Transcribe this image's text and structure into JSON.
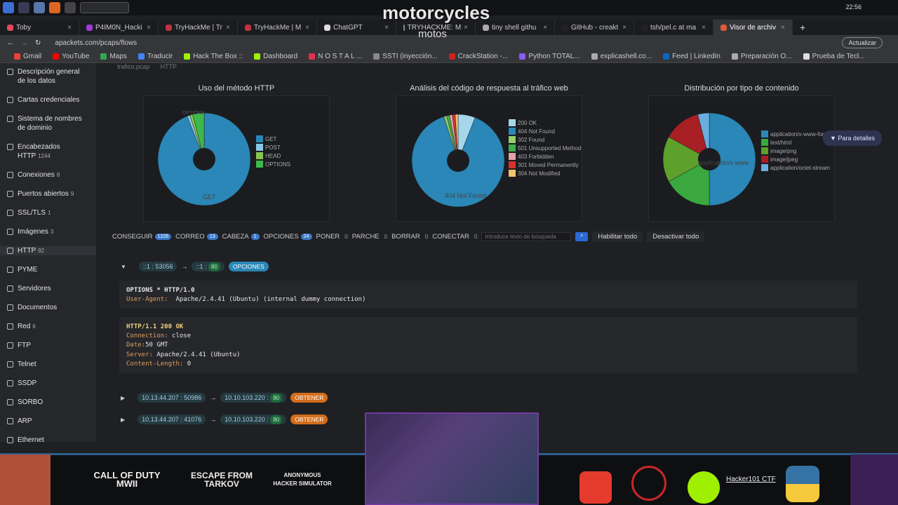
{
  "overlay": {
    "title": "motorcycles",
    "subtitle": "motos"
  },
  "system": {
    "clock": "22:56"
  },
  "tabs": [
    {
      "label": "Toby",
      "color": "#e04a5a"
    },
    {
      "label": "P4IM0N_Hacki",
      "color": "#a03bd8"
    },
    {
      "label": "TryHackMe | Tr",
      "color": "#c0333f"
    },
    {
      "label": "TryHackMe | M",
      "color": "#c0333f"
    },
    {
      "label": "ChatGPT",
      "color": "#dddddd"
    },
    {
      "label": "TRYHACKME: M",
      "color": "#888888"
    },
    {
      "label": "tiny shell githu",
      "color": "#aaaaaa"
    },
    {
      "label": "GitHub - creakt",
      "color": "#222222"
    },
    {
      "label": "tsh/pel.c at ma",
      "color": "#222222"
    },
    {
      "label": "Visor de archiv",
      "color": "#e05a3a"
    }
  ],
  "address": {
    "url": "apackets.com/pcaps/flows",
    "update": "Actualizar"
  },
  "bookmarks": [
    {
      "label": "Gmail",
      "color": "#ea4335"
    },
    {
      "label": "YouTube",
      "color": "#ff0000"
    },
    {
      "label": "Maps",
      "color": "#34a853"
    },
    {
      "label": "Traducir",
      "color": "#4285f4"
    },
    {
      "label": "Hack The Box ::",
      "color": "#9fef00"
    },
    {
      "label": "Dashboard",
      "color": "#9fef00"
    },
    {
      "label": "N O S T A L ...",
      "color": "#e0304e"
    },
    {
      "label": "SSTI (inyección...",
      "color": "#888888"
    },
    {
      "label": "CrackStation -...",
      "color": "#cc2222"
    },
    {
      "label": "Python TOTAL...",
      "color": "#8b5cf6"
    },
    {
      "label": "explicashell.co...",
      "color": "#aaaaaa"
    },
    {
      "label": "Feed | LinkedIn",
      "color": "#0a66c2"
    },
    {
      "label": "Preparación O...",
      "color": "#aaaaaa"
    },
    {
      "label": "Prueba de Tecl...",
      "color": "#dddddd"
    }
  ],
  "sidebar": [
    {
      "label": "Descripción general de los datos",
      "count": ""
    },
    {
      "label": "Cartas credenciales",
      "count": ""
    },
    {
      "label": "Sistema de nombres de dominio",
      "count": ""
    },
    {
      "label": "Encabezados HTTP",
      "count": "1244"
    },
    {
      "label": "Conexiones",
      "count": "8"
    },
    {
      "label": "Puertos abiertos",
      "count": "9"
    },
    {
      "label": "SSL/TLS",
      "count": "1"
    },
    {
      "label": "Imágenes",
      "count": "3"
    },
    {
      "label": "HTTP",
      "count": "92"
    },
    {
      "label": "PYME",
      "count": ""
    },
    {
      "label": "Servidores",
      "count": ""
    },
    {
      "label": "Documentos",
      "count": ""
    },
    {
      "label": "Red",
      "count": "6"
    },
    {
      "label": "FTP",
      "count": ""
    },
    {
      "label": "Telnet",
      "count": ""
    },
    {
      "label": "SSDP",
      "count": ""
    },
    {
      "label": "SORBO",
      "count": ""
    },
    {
      "label": "ARP",
      "count": ""
    },
    {
      "label": "Ethernet",
      "count": ""
    }
  ],
  "breadcrumb": {
    "file": "trafico.pcap",
    "section": "HTTP"
  },
  "details_button": "Para detalles",
  "chart_data": [
    {
      "type": "pie",
      "title": "Uso del método HTTP",
      "categories": [
        "GET",
        "POST",
        "HEAD",
        "OPTIONS"
      ],
      "values": [
        94,
        1,
        1,
        4
      ],
      "colors": [
        "#2a87b7",
        "#89c8e6",
        "#88c454",
        "#3db84a"
      ]
    },
    {
      "type": "pie",
      "title": "Análisis del código de respuesta al tráfico web",
      "categories": [
        "200 OK",
        "404 Not Found",
        "302 Found",
        "501 Unsupported Method",
        "403 Forbidden",
        "301 Moved Permanently",
        "304 Not Modified"
      ],
      "values": [
        6,
        89,
        1,
        1,
        1,
        1,
        1
      ],
      "colors": [
        "#a6d6ea",
        "#2a87b7",
        "#97cf6a",
        "#3fae49",
        "#e0a4a4",
        "#d93232",
        "#f2c36a"
      ]
    },
    {
      "type": "pie",
      "title": "Distribución por tipo de contenido",
      "categories": [
        "application/x-www-form-urlencoded",
        "text/html",
        "image/png",
        "image/jpeg",
        "application/octet-stream"
      ],
      "values": [
        50,
        17,
        16,
        13,
        4
      ],
      "colors": [
        "#2a87b7",
        "#3aa83e",
        "#5da02c",
        "#a81f24",
        "#6aaee0"
      ]
    }
  ],
  "chart_labels": {
    "c1_get": "GET",
    "c1_options": "OPTIONS",
    "c2_notfound": "404 Not Found",
    "c3_main": "application/x-www"
  },
  "filters": [
    {
      "label": "CONSEGUIR",
      "count": "1226"
    },
    {
      "label": "CORREO",
      "count": "13"
    },
    {
      "label": "CABEZA",
      "count": "1"
    },
    {
      "label": "OPCIONES",
      "count": "24"
    },
    {
      "label": "PONER",
      "count": "0"
    },
    {
      "label": "PARCHE",
      "count": "0"
    },
    {
      "label": "BORRAR",
      "count": "0"
    },
    {
      "label": "CONECTAR",
      "count": "0"
    }
  ],
  "search_placeholder": "Introduce texto de búsqueda",
  "enable_all": "Habilitar todo",
  "disable_all": "Desactivar todo",
  "flows": [
    {
      "src": "::1",
      "sport": "53056",
      "dst": "::1",
      "dport": "80",
      "method": "OPCIONES",
      "method_color": "#2a87b7"
    },
    {
      "src": "10.13.44.207",
      "sport": "50986",
      "dst": "10.10.103.220",
      "dport": "80",
      "method": "OBTENER",
      "method_color": "#d36d1b"
    },
    {
      "src": "10.13.44.207",
      "sport": "41076",
      "dst": "10.10.103.220",
      "dport": "80",
      "method": "OBTENER",
      "method_color": "#d36d1b"
    }
  ],
  "request": {
    "line": "OPTIONS * HTTP/1.0",
    "h1_k": "User-Agent:",
    "h1_v": "Apache/2.4.41 (Ubuntu) (internal dummy connection)"
  },
  "response": {
    "line": "HTTP/1.1 200 OK",
    "h1_k": "Connection:",
    "h1_v": "close",
    "h2_k": "Date:",
    "h2_v": "50 GMT",
    "h3_k": "Server:",
    "h3_v": "Apache/2.4.41 (Ubuntu)",
    "h4_k": "Content-Length:",
    "h4_v": "0"
  },
  "stream_bar": {
    "games": [
      "CALL OF DUTY MWII",
      "ESCAPE FROM TARKOV",
      "ANONYMOUS HACKER SIMULATOR"
    ],
    "site": "Hacker101 CTF"
  }
}
